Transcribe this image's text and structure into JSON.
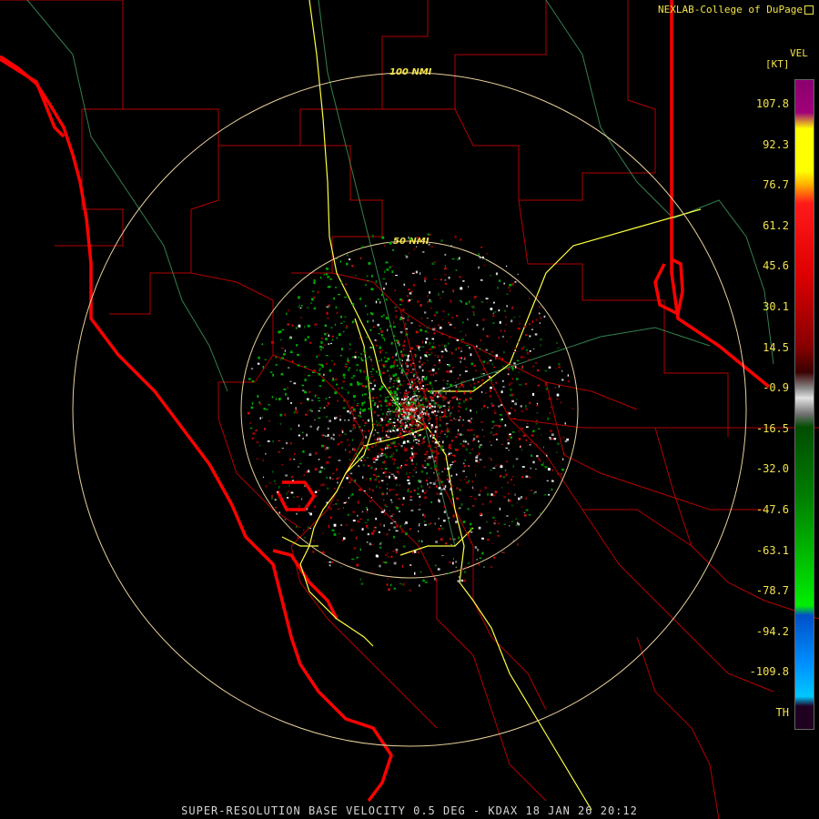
{
  "credit": "NEXLAB-College of DuPage",
  "legend": {
    "title": "VEL",
    "unit": "[KT]",
    "labels": [
      "107.8",
      "92.3",
      "76.7",
      "61.2",
      "45.6",
      "30.1",
      "14.5",
      "-0.9",
      "-16.5",
      "-32.0",
      "-47.6",
      "-63.1",
      "-78.7",
      "-94.2",
      "-109.8",
      "TH"
    ]
  },
  "rings": {
    "inner_label": "50 NMI",
    "outer_label": "100 NMI"
  },
  "footer": "SUPER-RESOLUTION BASE VELOCITY 0.5 DEG - KDAX 18 JAN 26 20:12",
  "colors": {
    "label": "#f3e34a",
    "state_border": "#ff0000",
    "county_border": "#b40000",
    "highway": "#ffff40",
    "ring": "#e8d09a",
    "river": "#40a060"
  }
}
